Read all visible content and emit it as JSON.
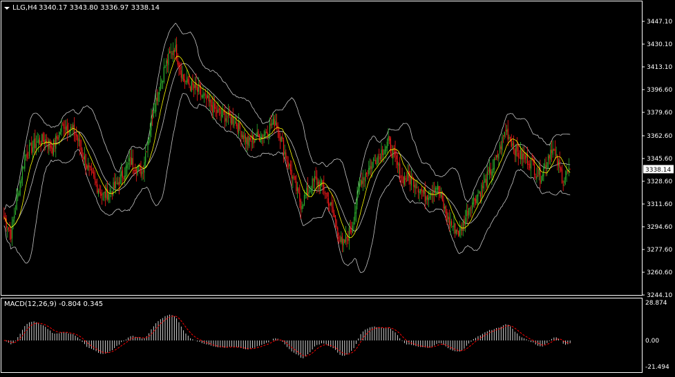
{
  "header": {
    "symbol_tf": "LLG,H4",
    "ohlc": "3340.17 3343.80 3336.97 3338.14"
  },
  "indicator": {
    "label": "MACD(12,26,9) -0.804 0.345"
  },
  "colors": {
    "background": "#000000",
    "bull": "#2fb62f",
    "bear": "#ff1a1a",
    "bands": "#c8c8c8",
    "ma": "#ffff00",
    "macd_hist": "#ffffff",
    "signal": "#ff0000",
    "axis": "#ffffff",
    "current_price_box": "#ffffff"
  },
  "chart_data": [
    {
      "type": "candlestick",
      "title": "",
      "ylim": [
        3244.1,
        3463.5
      ],
      "price_ticks": [
        "3447.10",
        "3430.10",
        "3413.10",
        "3396.60",
        "3379.60",
        "3362.60",
        "3345.60",
        "3328.60",
        "3311.60",
        "3294.60",
        "3277.60",
        "3260.60",
        "3244.10"
      ],
      "current_price": "3338.14",
      "overlays": [
        "Bollinger Bands (white)",
        "Moving Average (yellow)"
      ],
      "waypoints": [
        {
          "i": 0,
          "p": 3302
        },
        {
          "i": 6,
          "p": 3290
        },
        {
          "i": 18,
          "p": 3348
        },
        {
          "i": 28,
          "p": 3358
        },
        {
          "i": 36,
          "p": 3360
        },
        {
          "i": 42,
          "p": 3354
        },
        {
          "i": 52,
          "p": 3372
        },
        {
          "i": 62,
          "p": 3365
        },
        {
          "i": 74,
          "p": 3336
        },
        {
          "i": 86,
          "p": 3318
        },
        {
          "i": 96,
          "p": 3324
        },
        {
          "i": 110,
          "p": 3344
        },
        {
          "i": 120,
          "p": 3336
        },
        {
          "i": 130,
          "p": 3384
        },
        {
          "i": 140,
          "p": 3415
        },
        {
          "i": 148,
          "p": 3430
        },
        {
          "i": 156,
          "p": 3405
        },
        {
          "i": 170,
          "p": 3395
        },
        {
          "i": 186,
          "p": 3380
        },
        {
          "i": 200,
          "p": 3375
        },
        {
          "i": 212,
          "p": 3358
        },
        {
          "i": 226,
          "p": 3365
        },
        {
          "i": 236,
          "p": 3375
        },
        {
          "i": 246,
          "p": 3345
        },
        {
          "i": 258,
          "p": 3312
        },
        {
          "i": 270,
          "p": 3330
        },
        {
          "i": 278,
          "p": 3324
        },
        {
          "i": 286,
          "p": 3305
        },
        {
          "i": 294,
          "p": 3280
        },
        {
          "i": 302,
          "p": 3294
        },
        {
          "i": 310,
          "p": 3330
        },
        {
          "i": 322,
          "p": 3345
        },
        {
          "i": 334,
          "p": 3358
        },
        {
          "i": 346,
          "p": 3332
        },
        {
          "i": 356,
          "p": 3330
        },
        {
          "i": 366,
          "p": 3318
        },
        {
          "i": 376,
          "p": 3326
        },
        {
          "i": 386,
          "p": 3300
        },
        {
          "i": 396,
          "p": 3290
        },
        {
          "i": 404,
          "p": 3310
        },
        {
          "i": 416,
          "p": 3325
        },
        {
          "i": 428,
          "p": 3345
        },
        {
          "i": 436,
          "p": 3368
        },
        {
          "i": 446,
          "p": 3350
        },
        {
          "i": 456,
          "p": 3345
        },
        {
          "i": 466,
          "p": 3332
        },
        {
          "i": 476,
          "p": 3355
        },
        {
          "i": 486,
          "p": 3330
        },
        {
          "i": 492,
          "p": 3338
        }
      ]
    },
    {
      "type": "macd",
      "title": "",
      "ylim": [
        -21.494,
        28.874
      ],
      "ticks": [
        "28.874",
        "0.00",
        "-21.494"
      ],
      "params": "12,26,9",
      "macd_value": -0.804,
      "signal_value": 0.345
    }
  ]
}
